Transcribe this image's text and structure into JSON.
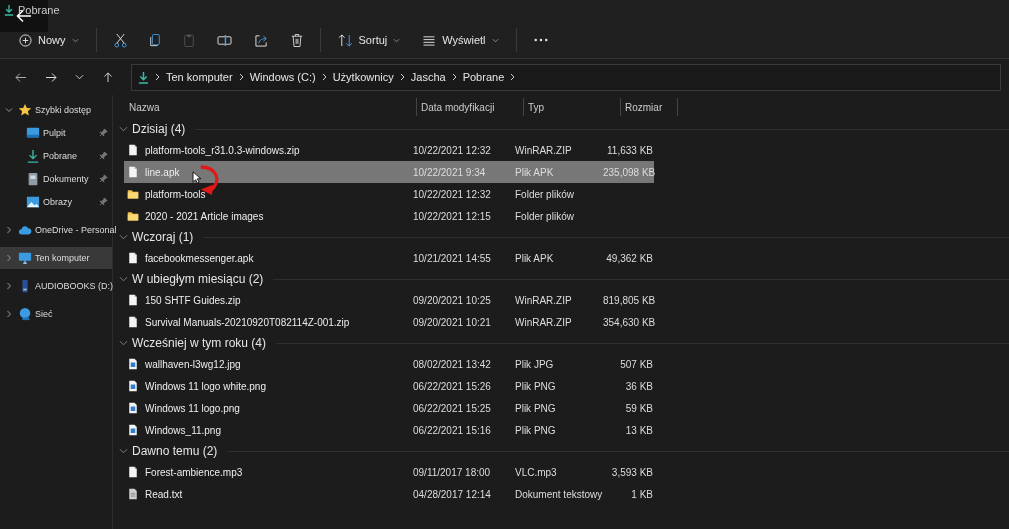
{
  "window": {
    "title": "Pobrane"
  },
  "toolbar": [
    {
      "kind": "new",
      "label": "Nowy",
      "disabled": false
    },
    {
      "kind": "cut",
      "disabled": false
    },
    {
      "kind": "copy",
      "disabled": false
    },
    {
      "kind": "paste",
      "disabled": true
    },
    {
      "kind": "rename",
      "disabled": false
    },
    {
      "kind": "share",
      "disabled": false
    },
    {
      "kind": "delete",
      "disabled": false
    },
    {
      "kind": "sort",
      "label": "Sortuj",
      "disabled": false
    },
    {
      "kind": "view",
      "label": "Wyświetl",
      "disabled": false
    },
    {
      "kind": "more",
      "disabled": false
    }
  ],
  "address": [
    "Ten komputer",
    "Windows (C:)",
    "Użytkownicy",
    "Jascha",
    "Pobrane"
  ],
  "sidebar": [
    {
      "label": "Szybki dostęp",
      "kind": "star",
      "expanded": true,
      "selected": false,
      "children": [
        {
          "label": "Pulpit",
          "kind": "desktop",
          "pinned": true,
          "selected": false
        },
        {
          "label": "Pobrane",
          "kind": "download",
          "pinned": true,
          "selected": false
        },
        {
          "label": "Dokumenty",
          "kind": "documents",
          "pinned": true,
          "selected": false
        },
        {
          "label": "Obrazy",
          "kind": "pictures",
          "pinned": true,
          "selected": false
        }
      ]
    },
    {
      "label": "OneDrive - Personal",
      "kind": "cloud",
      "expanded": false,
      "selected": false
    },
    {
      "label": "Ten komputer",
      "kind": "computer",
      "expanded": false,
      "selected": true
    },
    {
      "label": "AUDIOBOOKS (D:)",
      "kind": "drive",
      "expanded": false,
      "selected": false
    },
    {
      "label": "Sieć",
      "kind": "network",
      "expanded": false,
      "selected": false
    }
  ],
  "columns": [
    "Nazwa",
    "Data modyfikacji",
    "Typ",
    "Rozmiar"
  ],
  "groups": [
    {
      "title": "Dzisiaj (4)",
      "expanded": true,
      "rows": [
        {
          "name": "platform-tools_r31.0.3-windows.zip",
          "date": "10/22/2021 12:32",
          "type": "WinRAR.ZIP",
          "size": "11,633 KB",
          "kind": "file",
          "selected": false
        },
        {
          "name": "line.apk",
          "date": "10/22/2021 9:34",
          "type": "Plik APK",
          "size": "235,098 KB",
          "kind": "file",
          "selected": true
        },
        {
          "name": "platform-tools",
          "date": "10/22/2021 12:32",
          "type": "Folder plików",
          "kind": "folder",
          "selected": false
        },
        {
          "name": "2020 - 2021 Article images",
          "date": "10/22/2021 12:15",
          "type": "Folder plików",
          "kind": "folder",
          "selected": false
        }
      ]
    },
    {
      "title": "Wczoraj (1)",
      "expanded": true,
      "rows": [
        {
          "name": "facebookmessenger.apk",
          "date": "10/21/2021 14:55",
          "type": "Plik APK",
          "size": "49,362 KB",
          "kind": "file",
          "selected": false
        }
      ]
    },
    {
      "title": "W ubiegłym miesiącu (2)",
      "expanded": true,
      "rows": [
        {
          "name": "150 SHTF Guides.zip",
          "date": "09/20/2021 10:25",
          "type": "WinRAR.ZIP",
          "size": "819,805 KB",
          "kind": "file",
          "selected": false
        },
        {
          "name": "Survival Manuals-20210920T082114Z-001.zip",
          "date": "09/20/2021 10:21",
          "type": "WinRAR.ZIP",
          "size": "354,630 KB",
          "kind": "file",
          "selected": false
        }
      ]
    },
    {
      "title": "Wcześniej w tym roku (4)",
      "expanded": true,
      "rows": [
        {
          "name": "wallhaven-l3wg12.jpg",
          "date": "08/02/2021 13:42",
          "type": "Plik JPG",
          "size": "507 KB",
          "kind": "image",
          "selected": false
        },
        {
          "name": "Windows 11 logo white.png",
          "date": "06/22/2021 15:26",
          "type": "Plik PNG",
          "size": "36 KB",
          "kind": "image",
          "selected": false
        },
        {
          "name": "Windows 11 logo.png",
          "date": "06/22/2021 15:25",
          "type": "Plik PNG",
          "size": "59 KB",
          "kind": "image",
          "selected": false
        },
        {
          "name": "Windows_11.png",
          "date": "06/22/2021 15:16",
          "type": "Plik PNG",
          "size": "13 KB",
          "kind": "image",
          "selected": false
        }
      ]
    },
    {
      "title": "Dawno temu (2)",
      "expanded": true,
      "rows": [
        {
          "name": "Forest-ambience.mp3",
          "date": "09/11/2017 18:00",
          "type": "VLC.mp3",
          "size": "3,593 KB",
          "kind": "file",
          "selected": false
        },
        {
          "name": "Read.txt",
          "date": "04/28/2017 12:14",
          "type": "Dokument tekstowy",
          "size": "1 KB",
          "kind": "text",
          "selected": false
        }
      ]
    }
  ]
}
